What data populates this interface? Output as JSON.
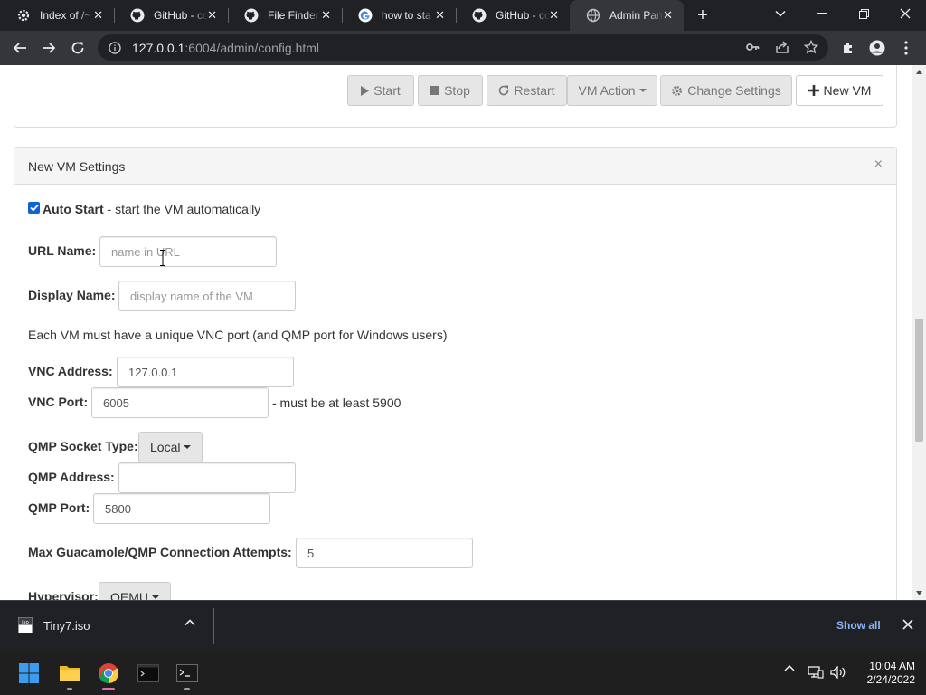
{
  "browser": {
    "tabs": [
      {
        "title": "Index of /~",
        "icon": "gear-icon"
      },
      {
        "title": "GitHub - co",
        "icon": "github-icon"
      },
      {
        "title": "File Finder",
        "icon": "github-icon"
      },
      {
        "title": "how to sta",
        "icon": "google-icon"
      },
      {
        "title": "GitHub - co",
        "icon": "github-icon"
      },
      {
        "title": "Admin Pan",
        "icon": "globe-icon",
        "active": true
      }
    ],
    "url_host": "127.0.0.1",
    "url_rest": ":6004/admin/config.html"
  },
  "actions": {
    "start": "Start",
    "stop": "Stop",
    "restart": "Restart",
    "vm_action": "VM Action",
    "change_settings": "Change Settings",
    "new_vm": "New VM"
  },
  "form": {
    "title": "New VM Settings",
    "close": "×",
    "auto_start_label": "Auto Start",
    "auto_start_desc": " - start the VM automatically",
    "auto_start_checked": true,
    "url_name_label": "URL Name:",
    "url_name_placeholder": "name in URL",
    "display_name_label": "Display Name:",
    "display_name_placeholder": "display name of the VM",
    "port_note": "Each VM must have a unique VNC port (and QMP port for Windows users)",
    "vnc_address_label": "VNC Address:",
    "vnc_address_value": "127.0.0.1",
    "vnc_port_label": "VNC Port:",
    "vnc_port_value": "6005",
    "vnc_port_note": "- must be at least 5900",
    "qmp_socket_type_label": "QMP Socket Type:",
    "qmp_socket_type_value": "Local",
    "qmp_address_label": "QMP Address:",
    "qmp_address_value": "",
    "qmp_port_label": "QMP Port:",
    "qmp_port_value": "5800",
    "max_attempts_label": "Max Guacamole/QMP Connection Attempts:",
    "max_attempts_value": "5",
    "hypervisor_label": "Hypervisor:",
    "hypervisor_value": "QEMU"
  },
  "download": {
    "filename": "Tiny7.iso",
    "show_all": "Show all"
  },
  "taskbar": {
    "time": "10:04 AM",
    "date": "2/24/2022"
  },
  "colors": {
    "accent": "#0b62d9",
    "chrome_dark": "#202124",
    "chrome_toolbar": "#35363a",
    "show_all_link": "#8ab4f8"
  }
}
